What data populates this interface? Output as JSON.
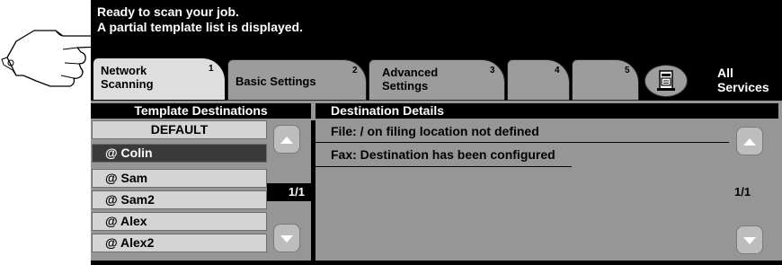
{
  "status": {
    "line1": "Ready to scan your job.",
    "line2": "A partial template list is displayed."
  },
  "tabs": [
    {
      "label_line1": "Network",
      "label_line2": "Scanning",
      "number": "1",
      "active": true
    },
    {
      "label_line1": "Basic Settings",
      "label_line2": "",
      "number": "2",
      "active": false
    },
    {
      "label_line1": "Advanced",
      "label_line2": "Settings",
      "number": "3",
      "active": false
    },
    {
      "label_line1": "",
      "label_line2": "",
      "number": "4",
      "active": false
    },
    {
      "label_line1": "",
      "label_line2": "",
      "number": "5",
      "active": false
    }
  ],
  "all_services": {
    "line1": "All",
    "line2": "Services"
  },
  "templates": {
    "header": "Template Destinations",
    "items": [
      "DEFAULT",
      "@ Colin",
      "@ Sam",
      "@ Sam2",
      "@ Alex",
      "@ Alex2"
    ],
    "selected": "@ Colin",
    "pager": "1/1"
  },
  "details": {
    "header": "Destination Details",
    "lines": [
      "File: / on filing location not defined",
      "Fax: Destination has been configured"
    ],
    "pager": "1/1"
  },
  "icons": {
    "pointer": "pointing-hand-icon",
    "services": "document-services-icon",
    "scroll_up": "up-arrow-icon",
    "scroll_down": "down-arrow-icon"
  }
}
